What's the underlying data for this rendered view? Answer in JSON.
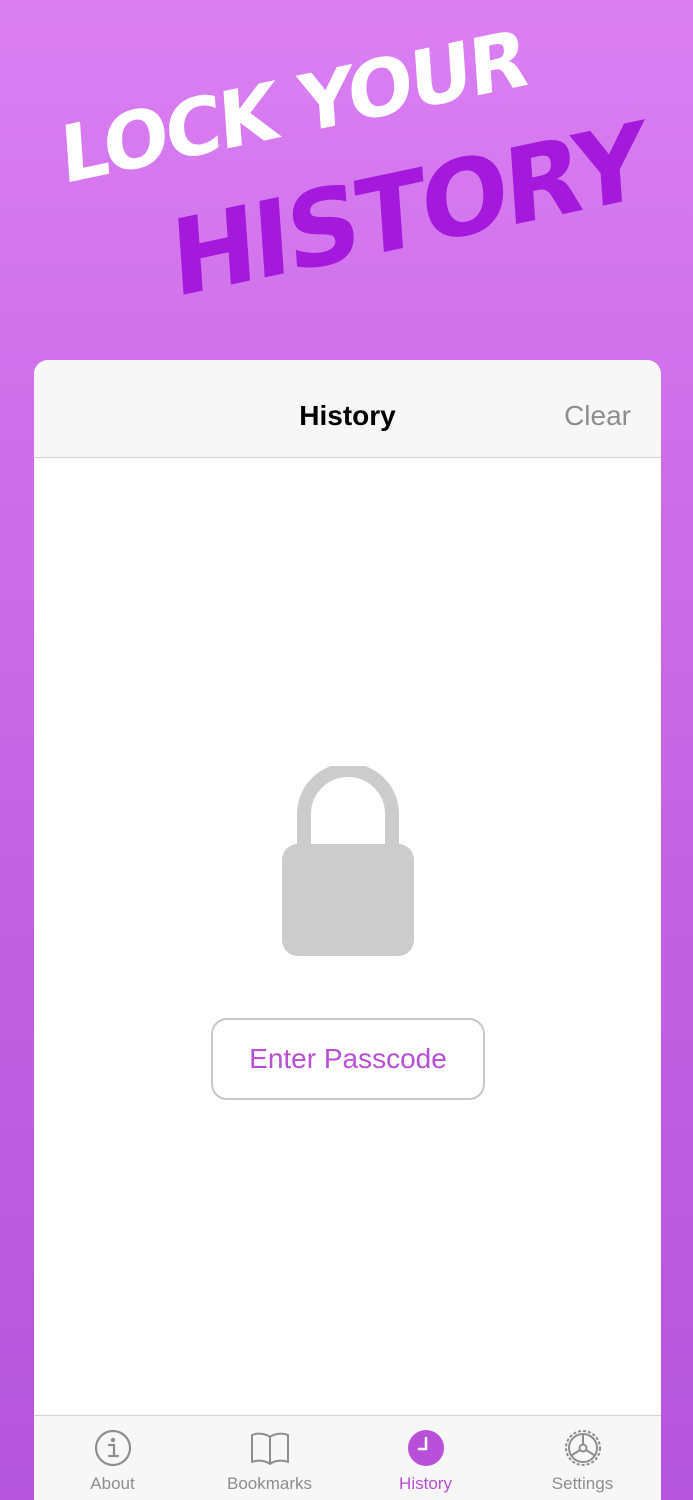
{
  "hero": {
    "line1": "LOCK YOUR",
    "line2": "HISTORY"
  },
  "nav": {
    "title": "History",
    "clear_label": "Clear"
  },
  "lock": {
    "button_label": "Enter Passcode"
  },
  "tabs": [
    {
      "label": "About",
      "icon": "info-icon"
    },
    {
      "label": "Bookmarks",
      "icon": "book-icon"
    },
    {
      "label": "History",
      "icon": "clock-icon",
      "active": true
    },
    {
      "label": "Settings",
      "icon": "gear-icon"
    }
  ],
  "colors": {
    "accent": "#b84fd8",
    "hero_highlight": "#a419dc",
    "background_top": "#db7ff3",
    "background_bottom": "#b455dc",
    "lock_gray": "#cccccc"
  }
}
